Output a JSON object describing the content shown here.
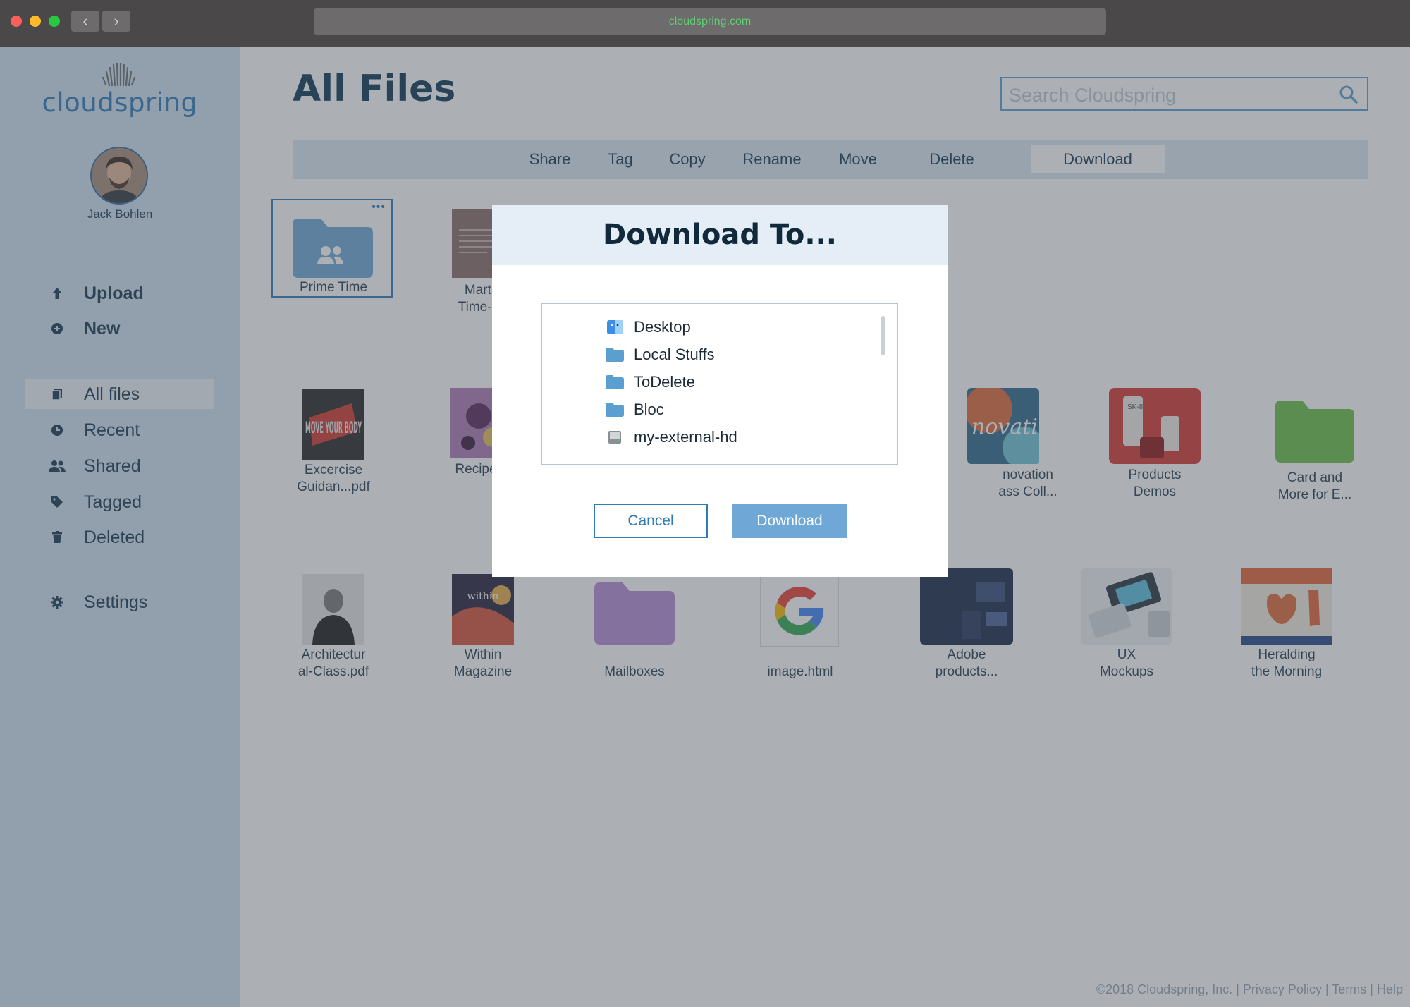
{
  "browser": {
    "url": "cloudspring.com",
    "back_glyph": "‹",
    "forward_glyph": "›"
  },
  "sidebar": {
    "logo": "cloudspring",
    "username": "Jack Bohlen",
    "actions": [
      {
        "label": "Upload",
        "icon": "arrow-up-icon"
      },
      {
        "label": "New",
        "icon": "plus-circle-icon"
      }
    ],
    "nav": [
      {
        "label": "All files",
        "icon": "files-icon",
        "active": true
      },
      {
        "label": "Recent",
        "icon": "clock-icon"
      },
      {
        "label": "Shared",
        "icon": "users-icon"
      },
      {
        "label": "Tagged",
        "icon": "tag-icon"
      },
      {
        "label": "Deleted",
        "icon": "trash-icon"
      }
    ],
    "settings": {
      "label": "Settings",
      "icon": "gear-icon"
    }
  },
  "main": {
    "title": "All Files",
    "search_placeholder": "Search Cloudspring",
    "toolbar": [
      "Share",
      "Tag",
      "Copy",
      "Rename",
      "Move",
      "Delete",
      "Download"
    ],
    "toolbar_active": "Download",
    "more_glyph": "•••",
    "files_row1": [
      {
        "line1": "Prime Time",
        "line2": ""
      },
      {
        "line1": "Marti",
        "line2": "Time-S"
      }
    ],
    "files_row2": [
      {
        "line1": "Excercise",
        "line2": "Guidan...pdf"
      },
      {
        "line1": "Recipe",
        "line2": ""
      },
      {
        "line1": "novation",
        "line2": "ass Coll..."
      },
      {
        "line1": "Products",
        "line2": "Demos"
      },
      {
        "line1": "Card and",
        "line2": "More for E..."
      }
    ],
    "files_row3": [
      {
        "line1": "Architectur",
        "line2": "al-Class.pdf"
      },
      {
        "line1": "Within",
        "line2": "Magazine"
      },
      {
        "line1": "Mailboxes",
        "line2": ""
      },
      {
        "line1": "image.html",
        "line2": ""
      },
      {
        "line1": "Adobe",
        "line2": "products..."
      },
      {
        "line1": "UX",
        "line2": "Mockups"
      },
      {
        "line1": "Heralding",
        "line2": "the Morning"
      }
    ],
    "thumb_texts": {
      "excercise": "MOVE YOUR BODY",
      "innovation": "novati",
      "within": "within",
      "skii": "SK-II"
    },
    "footer": "©2018 Cloudspring, Inc. | Privacy Policy | Terms | Help"
  },
  "modal": {
    "title": "Download To...",
    "locations": [
      {
        "label": "Desktop",
        "icon": "finder-icon"
      },
      {
        "label": "Local Stuffs",
        "icon": "folder-icon"
      },
      {
        "label": "ToDelete",
        "icon": "folder-icon"
      },
      {
        "label": "Bloc",
        "icon": "folder-icon"
      },
      {
        "label": "my-external-hd",
        "icon": "drive-icon"
      }
    ],
    "cancel_label": "Cancel",
    "download_label": "Download"
  },
  "colors": {
    "accent": "#2f7bb6",
    "sidebar_bg": "#cfe1ef",
    "toolbar_bg": "#dbe8f3",
    "title": "#0f3a55",
    "overlay": "rgba(70,80,90,0.45)"
  }
}
